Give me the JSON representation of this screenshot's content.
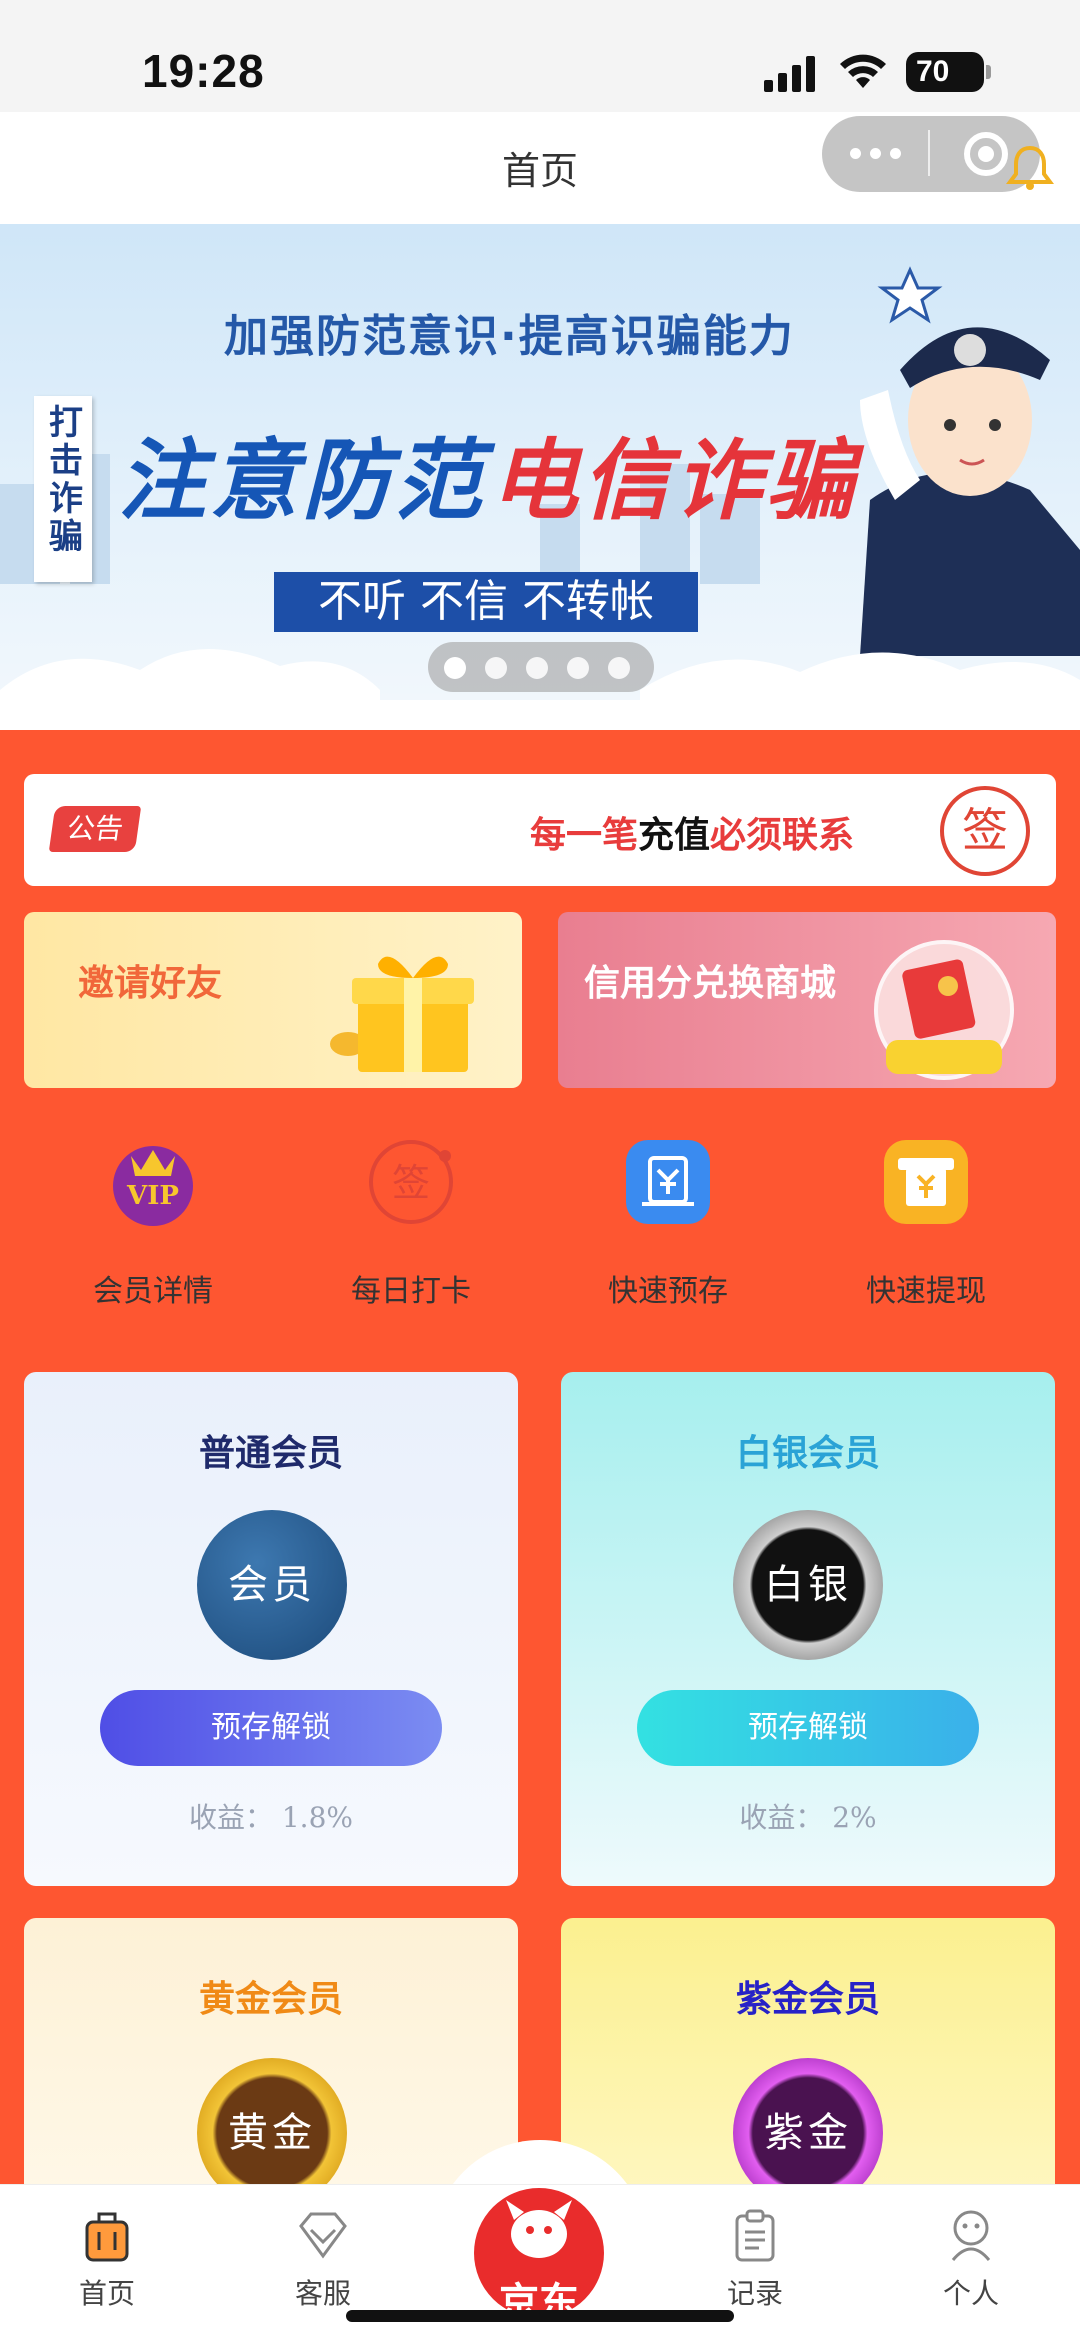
{
  "status_bar": {
    "time": "19:28",
    "battery": "70"
  },
  "nav": {
    "title": "首页"
  },
  "banner": {
    "subtitle": "加强防范意识·提高识骗能力",
    "vertical_tag": "打击诈骗",
    "headline_part1": "注意防范",
    "headline_part2": "电信诈骗",
    "slogan": "不听 不信 不转帐",
    "page_count": 5,
    "active_page": 1
  },
  "notice": {
    "badge": "公告",
    "text_red1": "每一笔",
    "text_black": "充值",
    "text_red2": "必须联系",
    "sign_label": "签"
  },
  "promo": {
    "invite_label": "邀请好友",
    "credit_label": "信用分兑换商城"
  },
  "quick_actions": [
    {
      "label": "会员详情",
      "icon": "vip-crown-icon"
    },
    {
      "label": "每日打卡",
      "icon": "sign-stamp-icon"
    },
    {
      "label": "快速预存",
      "icon": "deposit-yen-icon"
    },
    {
      "label": "快速提现",
      "icon": "withdraw-atm-icon"
    }
  ],
  "members": [
    {
      "title": "普通会员",
      "medal": "会员",
      "button": "预存解锁",
      "rate": "收益： 1.8%"
    },
    {
      "title": "白银会员",
      "medal": "白银",
      "button": "预存解锁",
      "rate": "收益： 2%"
    },
    {
      "title": "黄金会员",
      "medal": "黄金"
    },
    {
      "title": "紫金会员",
      "medal": "紫金"
    }
  ],
  "tabbar": {
    "home": "首页",
    "service": "客服",
    "center": "京东",
    "records": "记录",
    "profile": "个人"
  },
  "colors": {
    "accent_red": "#fe5631",
    "tab_center": "#e92c2c"
  }
}
